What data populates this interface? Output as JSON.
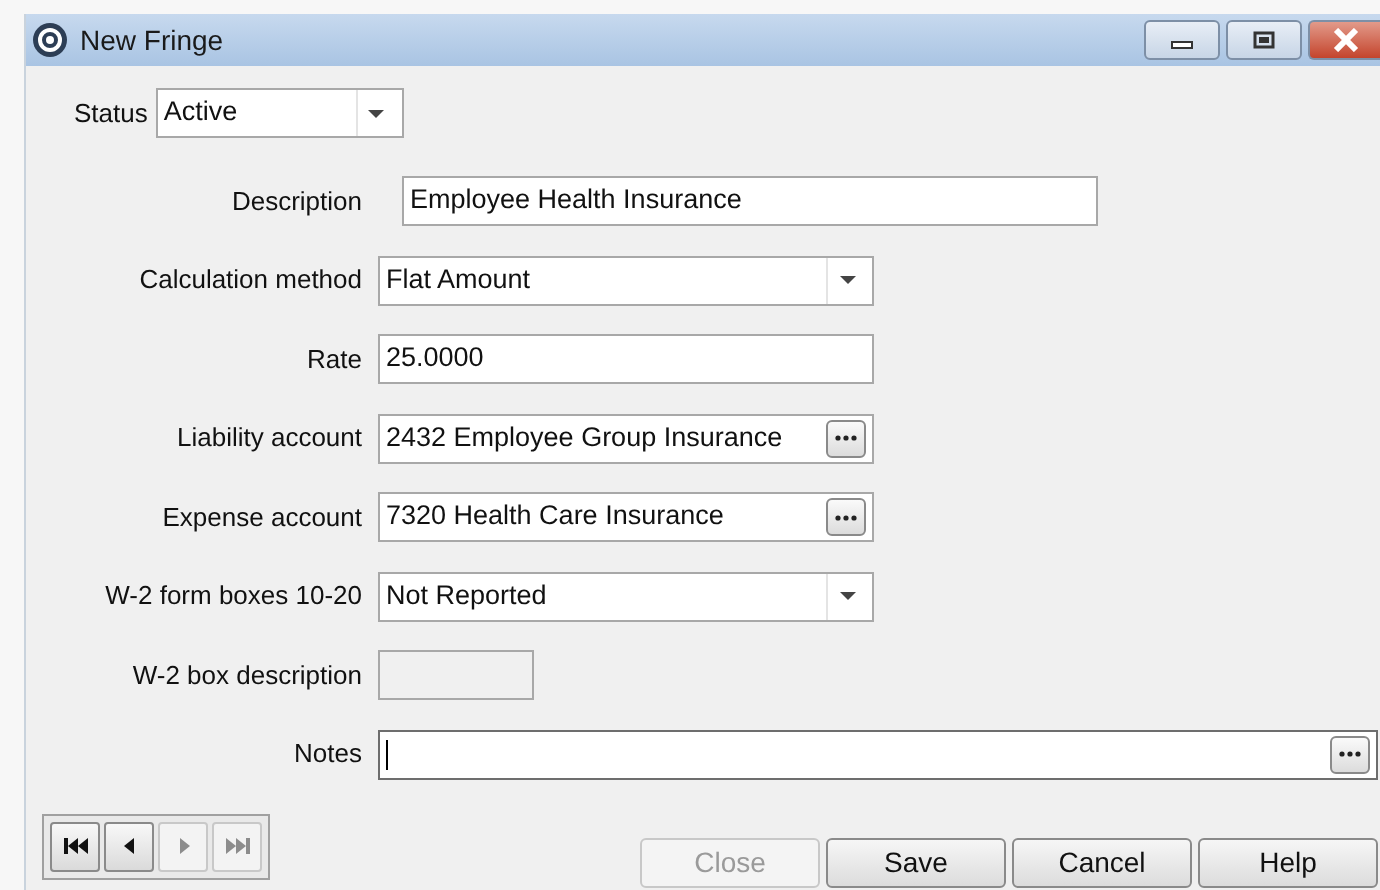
{
  "window": {
    "title": "New Fringe"
  },
  "status": {
    "label": "Status",
    "value": "Active"
  },
  "fields": [
    {
      "label": "Description",
      "kind": "text",
      "value": "Employee Health Insurance",
      "disabled": false,
      "focused": false
    },
    {
      "label": "Calculation method",
      "kind": "dropdown",
      "value": "Flat Amount",
      "disabled": false,
      "focused": false
    },
    {
      "label": "Rate",
      "kind": "text",
      "value": "25.0000",
      "disabled": false,
      "focused": false
    },
    {
      "label": "Liability account",
      "kind": "lookup",
      "value": "2432 Employee Group Insurance",
      "disabled": false,
      "focused": false
    },
    {
      "label": "Expense account",
      "kind": "lookup",
      "value": "7320 Health Care Insurance",
      "disabled": false,
      "focused": false
    },
    {
      "label": "W-2 form boxes 10-20",
      "kind": "dropdown",
      "value": "Not Reported",
      "disabled": false,
      "focused": false
    },
    {
      "label": "W-2 box description",
      "kind": "short",
      "disabled": true,
      "focused": false
    },
    {
      "label": "Notes",
      "kind": "lookup",
      "disabled": false,
      "focused": true
    }
  ],
  "navigator": [
    {
      "kind": "first",
      "disabled": false
    },
    {
      "kind": "prev",
      "disabled": false
    },
    {
      "kind": "next",
      "disabled": true
    },
    {
      "kind": "last",
      "disabled": true
    }
  ],
  "buttons": [
    {
      "label": "Close",
      "disabled": true
    },
    {
      "label": "Save",
      "disabled": false
    },
    {
      "label": "Cancel",
      "disabled": false
    },
    {
      "label": "Help",
      "disabled": false
    }
  ]
}
